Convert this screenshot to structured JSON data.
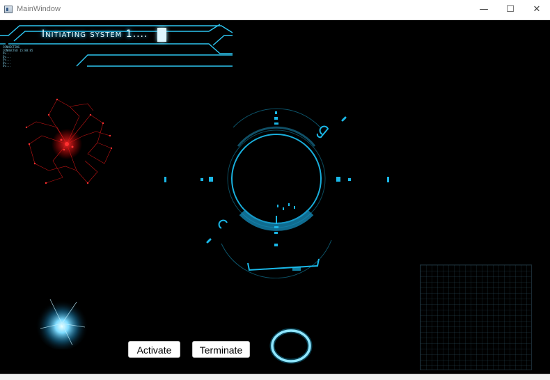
{
  "window": {
    "title": "MainWindow",
    "minimize": "—",
    "maximize": "☐",
    "close": "✕"
  },
  "banner": {
    "text": "Initiating system 1....",
    "logs": [
      "CONNECTING",
      "CONNECTED 15:88:85",
      "Ov...",
      "Ov...",
      "Ov...",
      "Ov...",
      "Ov..."
    ]
  },
  "buttons": {
    "activate": "Activate",
    "terminate": "Terminate"
  },
  "colors": {
    "hud_cyan": "#1ab8e8",
    "hud_dim": "#0e6a88",
    "red_viz": "#ff2020",
    "background": "#000000"
  }
}
